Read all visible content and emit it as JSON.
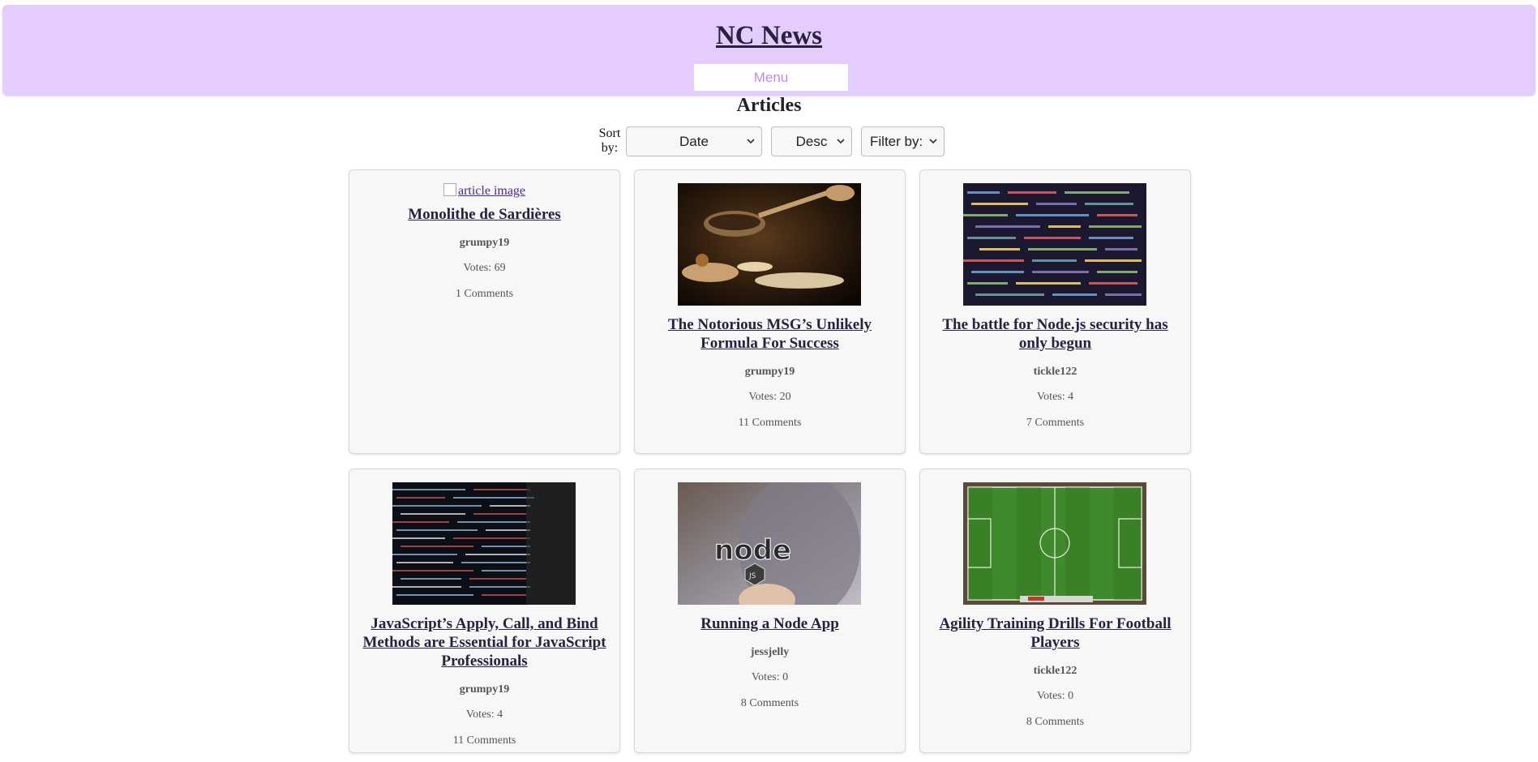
{
  "header": {
    "site_title": "NC News",
    "menu_label": "Menu",
    "background": "#e4ccff"
  },
  "main": {
    "heading": "Articles",
    "sort_label": "Sort by:",
    "sort_by_value": "Date",
    "order_value": "Desc",
    "filter_value": "Filter by:"
  },
  "articles": [
    {
      "title": "Monolithe de Sardières",
      "author": "grumpy19",
      "votes": "Votes: 69",
      "comments": "1 Comments",
      "image_alt": "article image",
      "image": "broken"
    },
    {
      "title": "The Notorious MSG’s Unlikely Formula For Success",
      "author": "grumpy19",
      "votes": "Votes: 20",
      "comments": "11 Comments",
      "image": "food-photo"
    },
    {
      "title": "The battle for Node.js security has only begun",
      "author": "tickle122",
      "votes": "Votes: 4",
      "comments": "7 Comments",
      "image": "code-screen-photo"
    },
    {
      "title": "JavaScript’s Apply, Call, and Bind Methods are Essential for JavaScript Professionals",
      "author": "grumpy19",
      "votes": "Votes: 4",
      "comments": "11 Comments",
      "image": "code-screen-dark-photo"
    },
    {
      "title": "Running a Node App",
      "author": "jessjelly",
      "votes": "Votes: 0",
      "comments": "8 Comments",
      "image": "nodejs-sticker-photo"
    },
    {
      "title": "Agility Training Drills For Football Players",
      "author": "tickle122",
      "votes": "Votes: 0",
      "comments": "8 Comments",
      "image": "football-pitch-photo"
    }
  ]
}
